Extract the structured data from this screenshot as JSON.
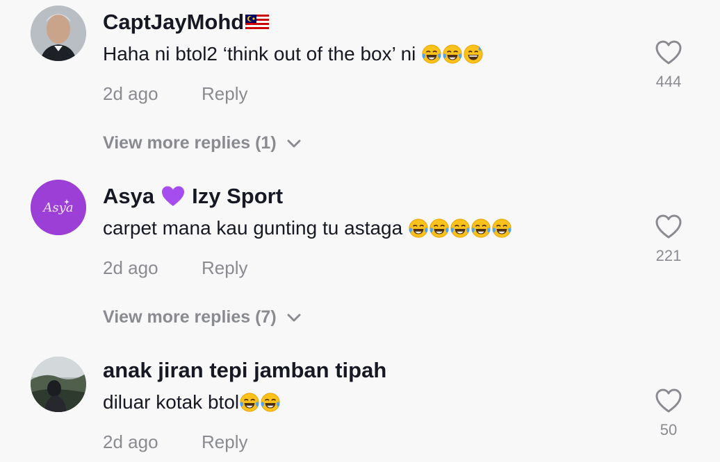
{
  "comments": [
    {
      "username": "CaptJayMohd",
      "text": "Haha ni btol2 ‘think out of the box’ ni ",
      "emojis": [
        "tears-of-joy",
        "tears-of-joy",
        "grinning-sweat"
      ],
      "time": "2d ago",
      "reply_label": "Reply",
      "likes": "444",
      "view_more": "View more replies (1)"
    },
    {
      "username_part1": "Asya",
      "username_part2": "Izy Sport",
      "avatar_text": "Asya",
      "text": "carpet mana kau gunting tu astaga ",
      "emojis": [
        "tears-of-joy",
        "tears-of-joy",
        "tears-of-joy",
        "tears-of-joy",
        "tears-of-joy"
      ],
      "time": "2d ago",
      "reply_label": "Reply",
      "likes": "221",
      "view_more": "View more replies (7)"
    },
    {
      "username": "anak jiran tepi jamban tipah",
      "text": "diluar kotak btol",
      "emojis": [
        "tears-of-joy",
        "tears-of-joy"
      ],
      "time": "2d ago",
      "reply_label": "Reply",
      "likes": "50"
    }
  ],
  "colors": {
    "background": "#f8f8f8",
    "primary_text": "#161823",
    "secondary_text": "#8a8b91",
    "avatar_purple": "#9b3fd6",
    "heart_purple": "#a64df0"
  }
}
